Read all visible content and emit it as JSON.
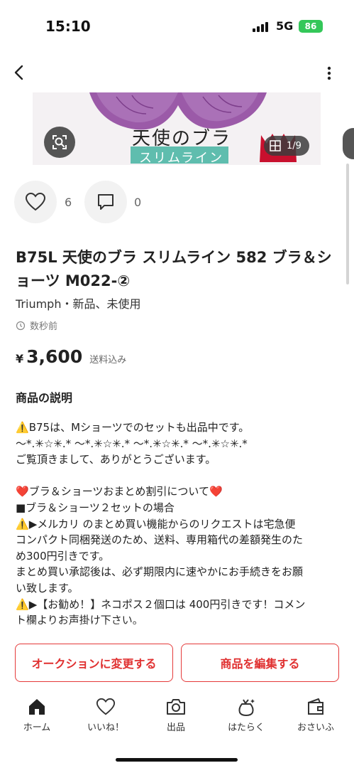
{
  "status": {
    "time": "15:10",
    "network": "5G",
    "battery": "86"
  },
  "gallery": {
    "overlay_text": "天使のブラ",
    "badge_text": "スリムライン",
    "counter": "1/9"
  },
  "reactions": {
    "likes": "6",
    "comments": "0"
  },
  "item": {
    "title": "B75L 天使のブラ スリムライン 582 ブラ＆ショーツ M022-②",
    "brand_condition": "Triumph・新品、未使用",
    "posted": "数秒前",
    "price_symbol": "¥",
    "price": "3,600",
    "shipping": "送料込み"
  },
  "description": {
    "heading": "商品の説明",
    "lines": [
      "B75は、Mショーツでのセットも出品中です。",
      "〜*.✳︎☆✳︎.* 〜*.✳︎☆✳︎.* 〜*.✳︎☆✳︎.* 〜*.✳︎☆✳︎.*",
      "ご覧頂きまして、ありがとうございます。",
      "",
      "ブラ＆ショーツおまとめ割引について",
      "■ブラ＆ショーツ２セットの場合",
      "▶︎メルカリ のまとめ買い機能からのリクエストは宅急便",
      "コンパクト同梱発送のため、送料、専用箱代の差額発生のた",
      "め300円引きです。",
      "まとめ買い承認後は、必ず期限内に速やかにお手続きをお願",
      "い致します。",
      "▶︎【お勧め！】ネコポス２個口は 400円引きです！コメン",
      "ト欄よりお声掛け下さい。"
    ]
  },
  "actions": {
    "auction": "オークションに変更する",
    "edit": "商品を編集する"
  },
  "tabs": [
    {
      "label": "ホーム",
      "icon": "home-icon"
    },
    {
      "label": "いいね！",
      "icon": "heart-icon"
    },
    {
      "label": "出品",
      "icon": "camera-icon"
    },
    {
      "label": "はたらく",
      "icon": "bag-icon"
    },
    {
      "label": "おさいふ",
      "icon": "wallet-icon"
    }
  ],
  "colors": {
    "accent": "#e53a3a",
    "battery": "#34c759",
    "warning": "#f5b400"
  }
}
